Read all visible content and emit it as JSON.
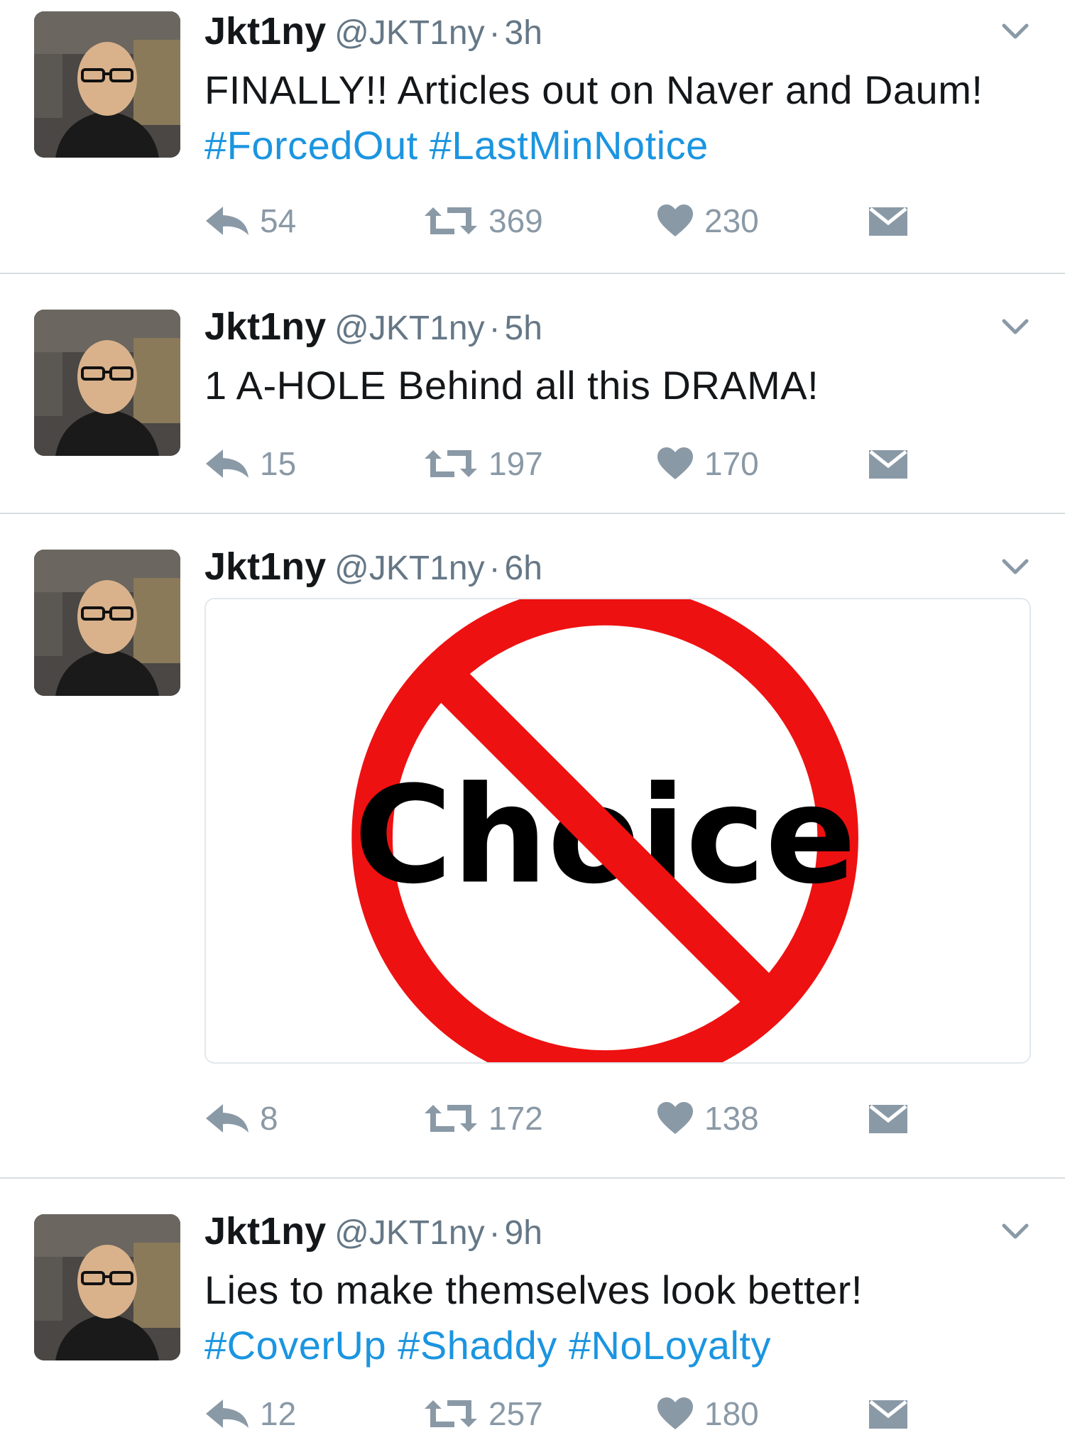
{
  "tweets": [
    {
      "name": "Jkt1ny",
      "handle": "@JKT1ny",
      "dot": "·",
      "time": "3h",
      "text_parts": [
        {
          "t": "FINALLY!! Articles out on Naver and Daum! ",
          "tag": false
        },
        {
          "t": "#ForcedOut",
          "tag": true
        },
        {
          "t": " ",
          "tag": false
        },
        {
          "t": "#LastMinNotice",
          "tag": true
        }
      ],
      "replies": "54",
      "retweets": "369",
      "likes": "230"
    },
    {
      "name": "Jkt1ny",
      "handle": "@JKT1ny",
      "dot": "·",
      "time": "5h",
      "text_parts": [
        {
          "t": "1 A-HOLE Behind all this DRAMA!",
          "tag": false
        }
      ],
      "replies": "15",
      "retweets": "197",
      "likes": "170"
    },
    {
      "name": "Jkt1ny",
      "handle": "@JKT1ny",
      "dot": "·",
      "time": "6h",
      "media_text": "Choice",
      "replies": "8",
      "retweets": "172",
      "likes": "138"
    },
    {
      "name": "Jkt1ny",
      "handle": "@JKT1ny",
      "dot": "·",
      "time": "9h",
      "text_parts": [
        {
          "t": "Lies to make themselves look better! ",
          "tag": false
        },
        {
          "t": "#CoverUp",
          "tag": true
        },
        {
          "t": " ",
          "tag": false
        },
        {
          "t": "#Shaddy",
          "tag": true
        },
        {
          "t": " ",
          "tag": false
        },
        {
          "t": "#NoLoyalty",
          "tag": true
        }
      ],
      "replies": "12",
      "retweets": "257",
      "likes": "180"
    }
  ],
  "icons": {
    "reply": "reply-icon",
    "retweet": "retweet-icon",
    "like": "heart-icon",
    "dm": "envelope-icon",
    "more": "chevron-down-icon"
  },
  "colors": {
    "hashtag": "#1b95e0",
    "meta": "#657786",
    "action": "#8a99a6",
    "prohibition_red": "#ee1111"
  }
}
